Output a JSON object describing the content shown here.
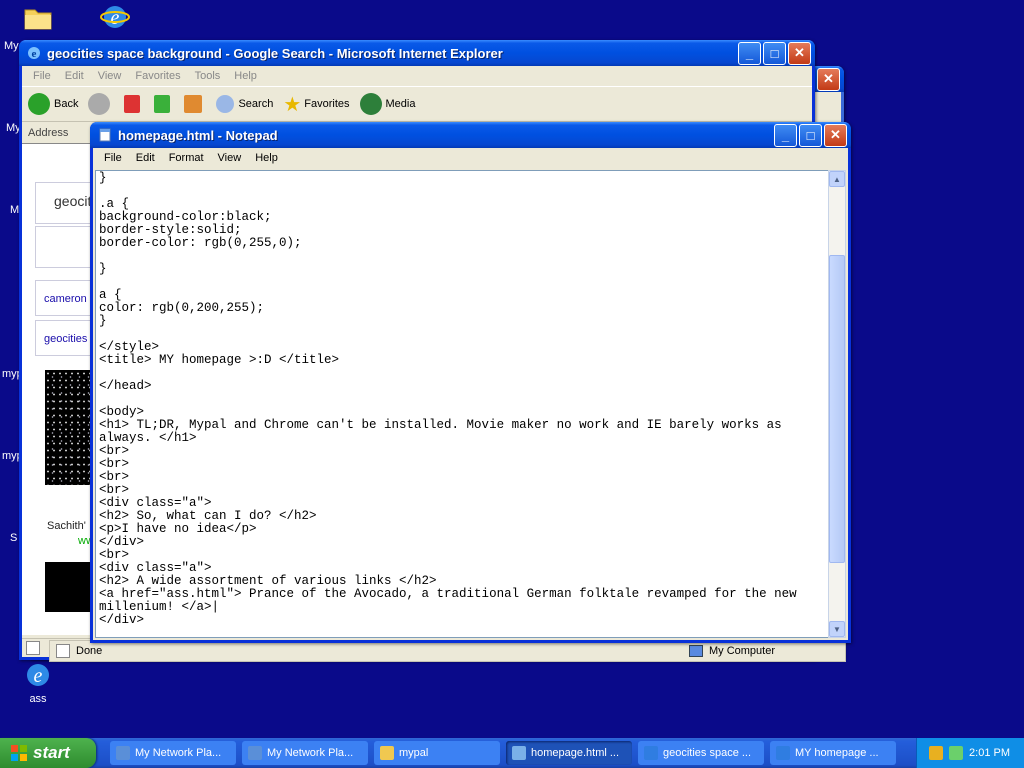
{
  "desktop": {
    "icons": [
      {
        "name": "mypal-folder-icon"
      },
      {
        "name": "internet-explorer-icon"
      },
      {
        "label": "ass",
        "name": "ass-html-icon"
      }
    ],
    "edge_labels": [
      "My",
      "My",
      "M",
      "myp",
      "myp",
      "S"
    ]
  },
  "ie_back_window": {
    "title": "geocities space background - Google Search - Microsoft Internet Explorer",
    "menu": [
      "File",
      "Edit",
      "View",
      "Favorites",
      "Tools",
      "Help"
    ],
    "toolbar": {
      "back": "Back",
      "search": "Search",
      "favorites": "Favorites",
      "media": "Media"
    },
    "address_label": "Address",
    "content": {
      "result_box": "geociti",
      "link_1": "cameron",
      "link_2": "geocities",
      "caption": "Sachith'",
      "caption_2": "ww"
    },
    "status_text": "Done",
    "zone_text": "My Computer"
  },
  "notepad": {
    "title": "homepage.html - Notepad",
    "menu": [
      "File",
      "Edit",
      "Format",
      "View",
      "Help"
    ],
    "text": "}\n\n.a {\nbackground-color:black;\nborder-style:solid;\nborder-color: rgb(0,255,0);\n\n}\n\na {\ncolor: rgb(0,200,255);\n}\n\n</style>\n<title> MY homepage >:D </title>\n\n</head>\n\n<body>\n<h1> TL;DR, Mypal and Chrome can't be installed. Movie maker no work and IE barely works as always. </h1>\n<br>\n<br>\n<br>\n<br>\n<div class=\"a\">\n<h2> So, what can I do? </h2>\n<p>I have no idea</p>\n</div>\n<br>\n<div class=\"a\">\n<h2> A wide assortment of various links </h2>\n<a href=\"ass.html\"> Prance of the Avocado, a traditional German folktale revamped for the new millenium! </a>|\n</div>"
  },
  "taskbar": {
    "start_label": "start",
    "tasks": [
      {
        "label": "My Network Pla...",
        "active": false,
        "color": "#5a8fd8"
      },
      {
        "label": "My Network Pla...",
        "active": false,
        "color": "#5a8fd8"
      },
      {
        "label": "mypal",
        "active": false,
        "color": "#f0c850"
      },
      {
        "label": "homepage.html ...",
        "active": true,
        "color": "#7ab0e8"
      },
      {
        "label": "geocities space ...",
        "active": false,
        "color": "#2f7de1"
      },
      {
        "label": "MY homepage ...",
        "active": false,
        "color": "#2f7de1"
      }
    ],
    "clock": "2:01 PM"
  }
}
